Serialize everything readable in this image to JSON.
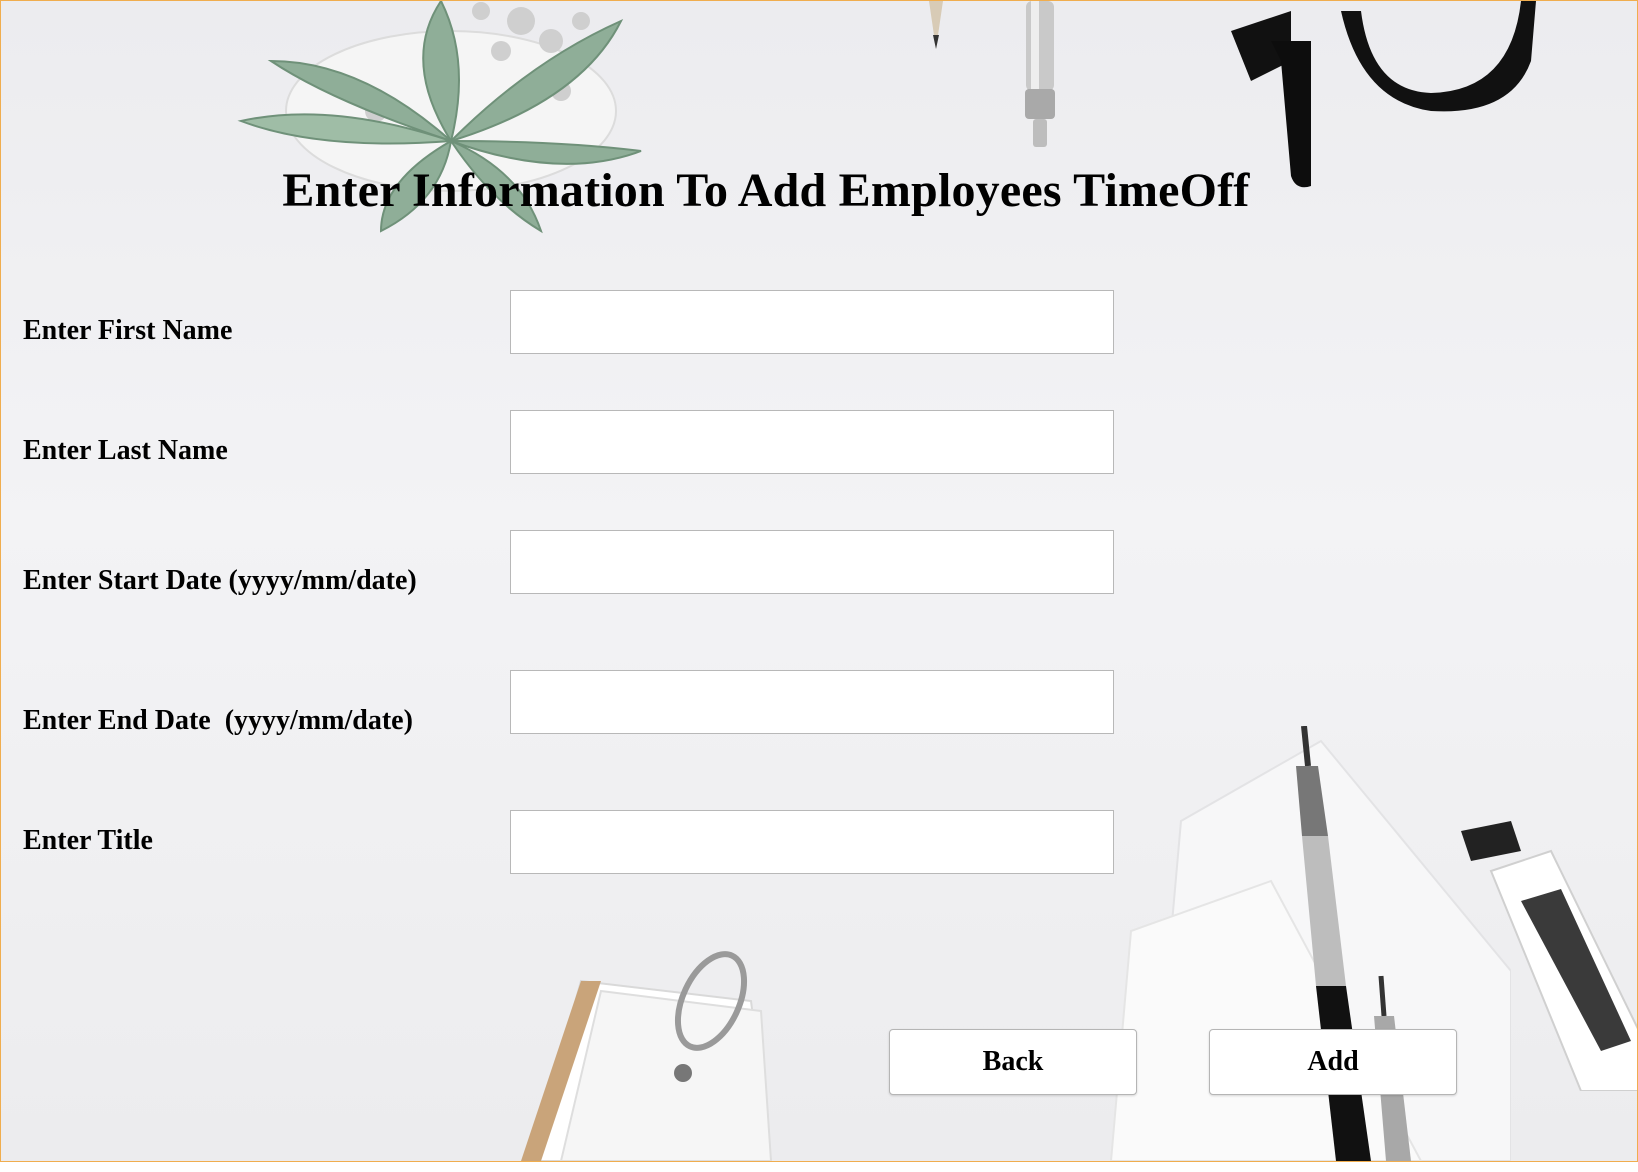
{
  "form": {
    "title": "Enter Information To Add Employees TimeOff",
    "fields": [
      {
        "label": "Enter First Name",
        "value": "",
        "placeholder": ""
      },
      {
        "label": "Enter Last Name",
        "value": "",
        "placeholder": ""
      },
      {
        "label": "Enter Start Date (yyyy/mm/date)",
        "value": "",
        "placeholder": ""
      },
      {
        "label": "Enter End Date  (yyyy/mm/date)",
        "value": "",
        "placeholder": ""
      },
      {
        "label": "Enter Title",
        "value": "",
        "placeholder": ""
      }
    ]
  },
  "buttons": {
    "back_label": "Back",
    "add_label": "Add"
  },
  "background": {
    "icons": [
      "succulent-plant-icon",
      "pencil-icon",
      "pen-icon",
      "eyeglasses-icon",
      "ring-notecards-icon",
      "mechanical-pencil-icon",
      "utility-knife-icon",
      "paper-sheets-icon"
    ]
  },
  "colors": {
    "window_border": "#f0ad4e",
    "background": "#efeff1",
    "text": "#000000"
  }
}
